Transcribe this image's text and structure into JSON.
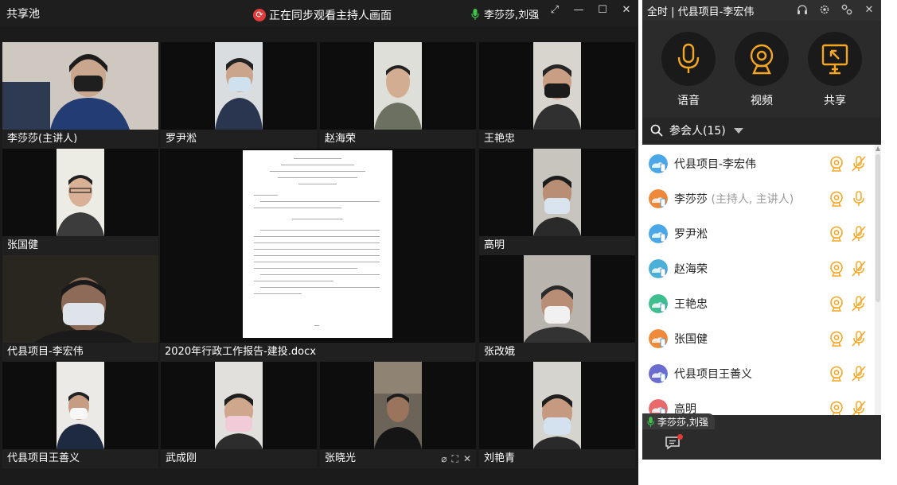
{
  "main": {
    "app_name": "共享池",
    "sync_text": "正在同步观看主持人画面",
    "speaking": "李莎莎,刘强",
    "window_buttons": [
      "⤢",
      "—",
      "☐",
      "✕"
    ]
  },
  "tiles": [
    {
      "label": "李莎莎(主讲人)"
    },
    {
      "label": "罗尹淞"
    },
    {
      "label": "赵海荣"
    },
    {
      "label": "王艳忠"
    },
    {
      "label": "张国健"
    },
    {
      "label": "高明"
    },
    {
      "label": "代县项目-李宏伟"
    },
    {
      "label": "张改娥"
    },
    {
      "label": "代县项目王善义"
    },
    {
      "label": "武成刚"
    },
    {
      "label": "张晓光"
    },
    {
      "label": "刘艳青"
    }
  ],
  "doc_tile": {
    "label": "2020年行政工作报告-建投.docx"
  },
  "panel": {
    "title": "全时 | 代县项目-李宏伟",
    "actions": [
      {
        "label": "语音"
      },
      {
        "label": "视频"
      },
      {
        "label": "共享"
      }
    ],
    "participants_label": "参会人(15)",
    "participants": [
      {
        "name": "代县项目-李宏伟",
        "role": "",
        "color": "#4aa8e8"
      },
      {
        "name": "李莎莎",
        "role": " (主持人, 主讲人)",
        "color": "#f0883a"
      },
      {
        "name": "罗尹淞",
        "role": "",
        "color": "#4aa8e8"
      },
      {
        "name": "赵海荣",
        "role": "",
        "color": "#4ab0d8"
      },
      {
        "name": "王艳忠",
        "role": "",
        "color": "#3fbf8f"
      },
      {
        "name": "张国健",
        "role": "",
        "color": "#f08a3a"
      },
      {
        "name": "代县项目王善义",
        "role": "",
        "color": "#6b6bd0"
      },
      {
        "name": "高明",
        "role": "",
        "color": "#e86a6a"
      }
    ],
    "speaking_tag": "李莎莎,刘强"
  },
  "colors": {
    "accent": "#f5a623",
    "speaking_green": "#3fc24a"
  }
}
